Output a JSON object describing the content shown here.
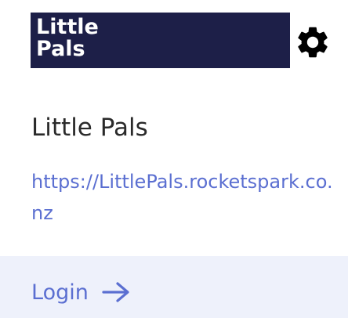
{
  "brand": {
    "logo_line1": "Little",
    "logo_line2": "Pals",
    "logo_bg_color": "#1d1f48"
  },
  "header": {
    "settings_icon": "gear-icon"
  },
  "site": {
    "name": "Little Pals",
    "url": "https://LittlePals.rocketspark.co.nz"
  },
  "actions": {
    "login_label": "Login",
    "login_icon": "arrow-right-icon"
  },
  "colors": {
    "link": "#5b6fd1",
    "login_bar_bg": "#eef1fb",
    "text": "#2a2a2a"
  }
}
